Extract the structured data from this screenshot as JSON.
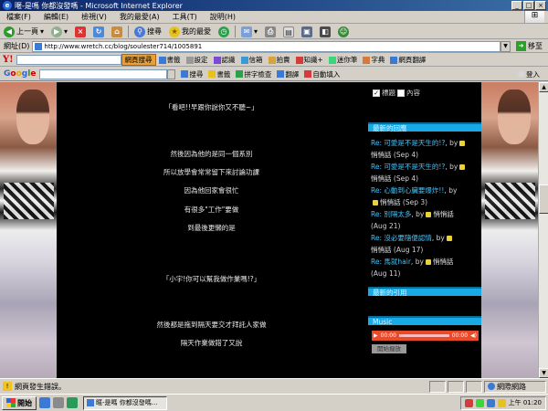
{
  "window": {
    "title": "暱-是嗎 你都沒發嗎 - Microsoft Internet Explorer",
    "controls": [
      "_",
      "□",
      "×"
    ]
  },
  "menu": [
    "檔案(F)",
    "編輯(E)",
    "檢視(V)",
    "我的最愛(A)",
    "工具(T)",
    "說明(H)"
  ],
  "toolbar": {
    "back": "上一頁",
    "search": "搜尋",
    "favorites": "我的最愛"
  },
  "address": {
    "label": "網址(D)",
    "url": "http://www.wretch.cc/blog/soulester714/1005891",
    "go": "移至"
  },
  "yahoo": {
    "logo": "Y!",
    "items": [
      "網頁搜尋",
      "書籤",
      "設定",
      "認識",
      "信箱",
      "拍賣",
      "知識+",
      "迷你筆",
      "字典",
      "網頁翻譯"
    ]
  },
  "google": {
    "logo": [
      "G",
      "o",
      "o",
      "g",
      "l",
      "e"
    ],
    "items": [
      "搜尋",
      "書籤",
      "拼字檢查",
      "翻譯",
      "自動填入"
    ],
    "login": "登入"
  },
  "post": {
    "lines": [
      "「看吧!!早跟你說你又不聽~」",
      "然後因為他的是同一個系別",
      "所以放學會常常留下來討論功課",
      "因為他回家會很忙",
      "有很多\"工作\"要做",
      "到最後更懶的是",
      "「小宇!你可以幫我做作業嗎!?」",
      "然後都是拖到隔天要交才拜託人家做",
      "隔天作業做錯了又說"
    ]
  },
  "sidebar": {
    "filters": [
      "標題",
      "內容"
    ],
    "recent_comments_title": "最新的回應",
    "comments": [
      {
        "link": "Re: 可愛是不是天生的!?",
        "by": ", by",
        "user": "悄悄話",
        "date": "(Sep 4)"
      },
      {
        "link": "Re: 可愛是不是天生的!?",
        "by": ", by",
        "user": "悄悄話",
        "date": "(Sep 4)"
      },
      {
        "link": "Re: 心動到心臟要爆炸!!",
        "by": ", by",
        "user": "悄悄話",
        "date": "(Sep 3)"
      },
      {
        "link": "Re: 別隔太多",
        "by": ", by",
        "user": "悄悄話",
        "date": "(Aug 21)"
      },
      {
        "link": "Re: 沒必要隨便認情",
        "by": ", by",
        "user": "悄悄話",
        "date": "(Aug 17)"
      },
      {
        "link": "Re: 馬就hair",
        "by": ", by",
        "user": "悄悄話",
        "date": "(Aug 11)"
      }
    ],
    "recent_trackbacks_title": "最新的引用",
    "music_title": "Music",
    "music_player": {
      "elapsed": "00:00",
      "total": "00:00"
    },
    "music_button": "開始撥放"
  },
  "status": {
    "text": "網頁發生錯誤。",
    "zone": "網際網路"
  },
  "taskbar": {
    "start": "開始",
    "task": "暱-是嗎 你都沒發嗎...",
    "clock": "上午 01:20"
  }
}
